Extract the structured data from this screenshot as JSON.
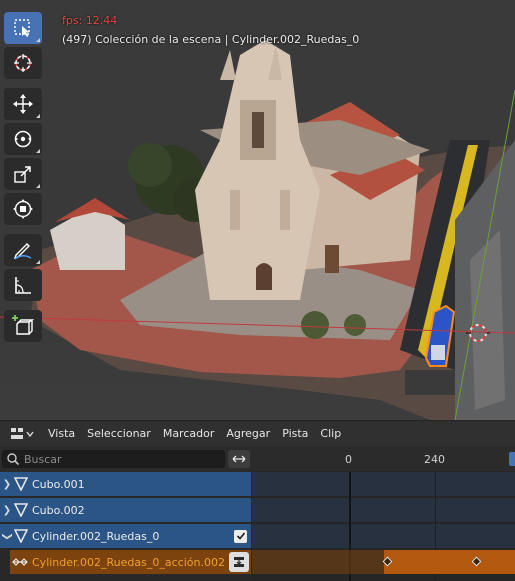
{
  "viewport": {
    "fps_text": "fps: 12.44",
    "collection_text": "(497) Colección de la escena | Cylinder.002_Ruedas_0",
    "tools": [
      {
        "name": "select-box",
        "active": true
      },
      {
        "name": "cursor"
      },
      {
        "name": "move"
      },
      {
        "name": "rotate"
      },
      {
        "name": "scale"
      },
      {
        "name": "transform"
      },
      {
        "name": "annotate"
      },
      {
        "name": "measure"
      },
      {
        "name": "add-cube"
      }
    ]
  },
  "menubar": {
    "items": [
      "Vista",
      "Seleccionar",
      "Marcador",
      "Agregar",
      "Pista",
      "Clip"
    ]
  },
  "search": {
    "placeholder": "Buscar"
  },
  "channels": [
    {
      "label": "Cubo.001"
    },
    {
      "label": "Cubo.002"
    },
    {
      "label": "Cylinder.002_Ruedas_0",
      "checked": true
    },
    {
      "label": "Cylinder.002_Ruedas_0_acción.002"
    }
  ],
  "ruler": {
    "ticks": [
      "0",
      "240"
    ]
  },
  "colors": {
    "accent": "#4772b3",
    "channel_blue": "#2a5586",
    "action_orange": "#b45a10",
    "fps_red": "#e04848"
  }
}
